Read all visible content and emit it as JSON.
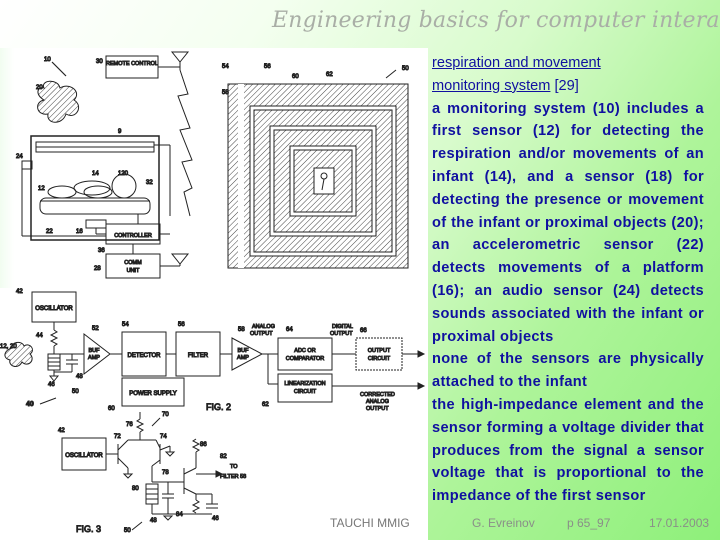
{
  "slide": {
    "title": "Engineering basics for computer interaction",
    "heading": {
      "link_text_line1": "respiration and movement",
      "link_text_line2": "monitoring system",
      "reference": "[29]"
    },
    "paragraphs": [
      "a monitoring system (10) includes a first sensor (12) for detecting the respiration and/or movements of an infant (14), and a sensor (18) for detecting the presence or movement of the infant or proximal objects (20); an accelerometric sensor (22) detects movements of a platform (16); an audio sensor (24) detects sounds associated with the infant or proximal objects",
      "none of the sensors are physically attached to the infant",
      "the high-impedance element and the sensor forming a voltage divider that produces from the signal a sensor voltage that is proportional to the impedance of the first sensor"
    ],
    "footer": {
      "organization": "TAUCHI MMIG",
      "author": "G. Evreinov",
      "page": "p 65_97",
      "date": "17.01.2003"
    }
  },
  "figure": {
    "fig1": {
      "remote_control": "REMOTE CONTROL",
      "controller": "CONTROLLER",
      "comm_unit_line1": "COMM",
      "comm_unit_line2": "UNIT",
      "refs": [
        "10",
        "30",
        "20",
        "9",
        "24",
        "14",
        "120",
        "12",
        "22",
        "16",
        "32",
        "36",
        "28"
      ]
    },
    "coil": {
      "refs": [
        "54",
        "56",
        "58",
        "60",
        "62",
        "50"
      ]
    },
    "fig2": {
      "oscillator": "OSCILLATOR",
      "buf_amp_line1": "BUF",
      "buf_amp_line2": "AMP",
      "detector": "DETECTOR",
      "filter": "FILTER",
      "analog_output_line1": "ANALOG",
      "analog_output_line2": "OUTPUT",
      "digital_output_line1": "DIGITAL",
      "digital_output_line2": "OUTPUT",
      "adc_line1": "ADC OR",
      "adc_line2": "COMPARATOR",
      "output_circuit_line1": "OUTPUT",
      "output_circuit_line2": "CIRCUIT",
      "linearization_line1": "LINEARIZATION",
      "linearization_line2": "CIRCUIT",
      "corrected_line1": "CORRECTED",
      "corrected_line2": "ANALOG",
      "corrected_line3": "OUTPUT",
      "power_supply": "POWER SUPPLY",
      "caption": "FIG. 2",
      "refs": [
        "42",
        "44",
        "46",
        "48",
        "50",
        "40",
        "52",
        "54",
        "56",
        "58",
        "60",
        "62",
        "64",
        "66",
        "12, 20"
      ]
    },
    "fig3": {
      "oscillator": "OSCILLATOR",
      "to_filter_line1": "TO",
      "to_filter_line2": "FILTER 58",
      "caption": "FIG. 3",
      "refs": [
        "42",
        "70",
        "72",
        "74",
        "76",
        "78",
        "80",
        "82",
        "84",
        "86",
        "46",
        "48",
        "50"
      ]
    }
  }
}
